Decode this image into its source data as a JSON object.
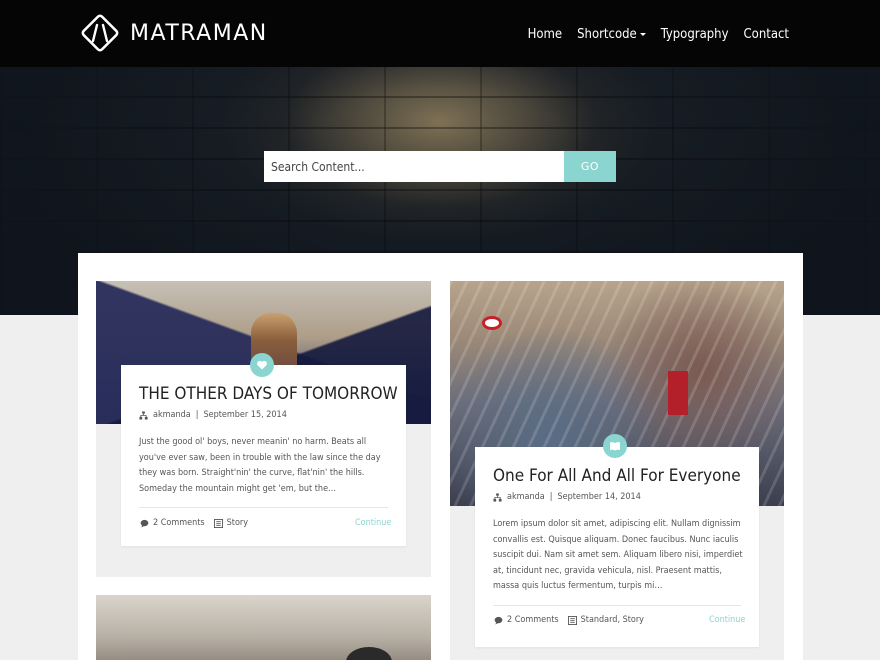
{
  "header": {
    "logo_text": "MATRAMAN",
    "nav": [
      {
        "label": "Home"
      },
      {
        "label": "Shortcode"
      },
      {
        "label": "Typography"
      },
      {
        "label": "Contact"
      }
    ]
  },
  "search": {
    "placeholder": "Search Content...",
    "button_label": "GO"
  },
  "posts": [
    {
      "title": "THE OTHER DAYS OF TOMORROW",
      "author": "akmanda",
      "date": "September 15, 2014",
      "excerpt": "Just the good ol' boys, never meanin' no harm. Beats all you've ever saw, been in trouble with the law since the day they was born. Straight'nin' the curve, flat'nin' the hills. Someday the mountain might get 'em, but the…",
      "comments": "2 Comments",
      "categories": "Story",
      "continue": "Continue"
    },
    {
      "title": "One For All And All For Everyone",
      "author": "akmanda",
      "date": "September 14, 2014",
      "excerpt": "Lorem ipsum dolor sit amet, adipiscing elit. Nullam dignissim convallis est. Quisque aliquam. Donec faucibus. Nunc iaculis suscipit dui. Nam sit amet sem. Aliquam libero nisi, imperdiet at, tincidunt nec, gravida vehicula, nisl. Praesent mattis, massa quis luctus fermentum, turpis mi…",
      "comments": "2 Comments",
      "categories": "Standard, Story",
      "continue": "Continue"
    }
  ],
  "colors": {
    "accent": "#8ad5cf",
    "header_bg": "#050505",
    "page_bg": "#efefef"
  }
}
